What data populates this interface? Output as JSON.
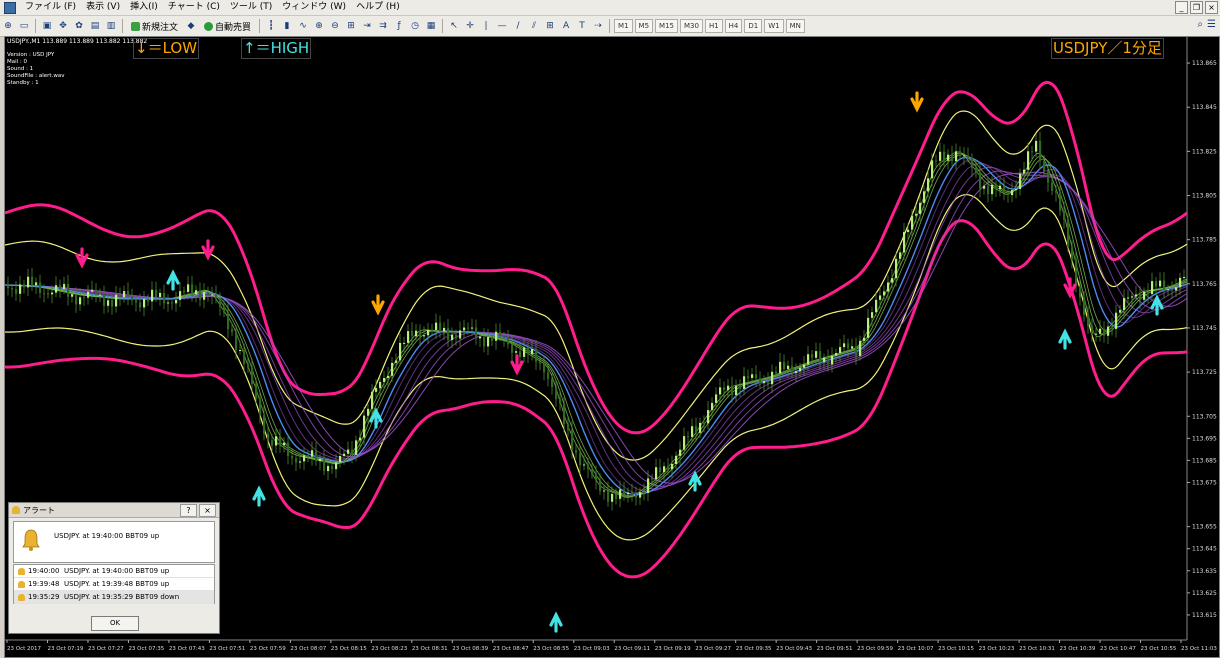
{
  "menu": {
    "items": [
      "ファイル (F)",
      "表示 (V)",
      "挿入(I)",
      "チャート (C)",
      "ツール (T)",
      "ウィンドウ (W)",
      "ヘルプ (H)"
    ]
  },
  "window_controls": [
    "_",
    "❐",
    "×"
  ],
  "toolbar": {
    "new_order": "新規注文",
    "auto_trade": "自動売買",
    "draw_tools": [
      "|",
      "—",
      "/",
      "⫽",
      "⊞",
      "A",
      "T"
    ],
    "timeframes": [
      "M1",
      "M5",
      "M15",
      "M30",
      "H1",
      "H4",
      "D1",
      "W1",
      "MN"
    ]
  },
  "chart_window": {
    "symbol_line": "USDJPY.,M1  113.889 113.889 113.882 113.882",
    "info": [
      "Version : USD JPY",
      "Mail : 0",
      "Sound : 1",
      "SoundFile : alert.wav",
      "Standby : 1"
    ],
    "legend_low": "↓＝LOW",
    "legend_high": "↑＝HIGH",
    "chart_title": "USDJPY／1分足",
    "colors": {
      "background": "#000000",
      "outer_band": "#ff1c8c",
      "inner_band": "#f2f27a",
      "ma_blue": "#4b8cf0",
      "ma_purple": "#a050d0",
      "candles": "#b6f07a",
      "low_arrow": "#ffa500",
      "high_arrow": "#43e3e3"
    }
  },
  "alert_dialog": {
    "title": "アラート",
    "buttons": [
      "?",
      "×"
    ],
    "message": "USDJPY. at 19:40:00 BBT09 up",
    "rows": [
      {
        "time": "19:40:00",
        "text": "USDJPY. at 19:40:00 BBT09 up"
      },
      {
        "time": "19:39:48",
        "text": "USDJPY. at 19:39:48 BBT09 up"
      },
      {
        "time": "19:35:29",
        "text": "USDJPY. at 19:35:29 BBT09 down"
      }
    ],
    "ok_label": "OK"
  },
  "chart_data": {
    "type": "line",
    "title": "USDJPY／1分足",
    "y_ticks": [
      113.865,
      113.845,
      113.825,
      113.805,
      113.785,
      113.765,
      113.745,
      113.725,
      113.705,
      113.695,
      113.685,
      113.675,
      113.655,
      113.645,
      113.635,
      113.625,
      113.615
    ],
    "x_ticks": [
      "23 Oct 2017",
      "23 Oct 07:19",
      "23 Oct 07:27",
      "23 Oct 07:35",
      "23 Oct 07:43",
      "23 Oct 07:51",
      "23 Oct 07:59",
      "23 Oct 08:07",
      "23 Oct 08:15",
      "23 Oct 08:23",
      "23 Oct 08:31",
      "23 Oct 08:39",
      "23 Oct 08:47",
      "23 Oct 08:55",
      "23 Oct 09:03",
      "23 Oct 09:11",
      "23 Oct 09:19",
      "23 Oct 09:27",
      "23 Oct 09:35",
      "23 Oct 09:43",
      "23 Oct 09:51",
      "23 Oct 09:59",
      "23 Oct 10:07",
      "23 Oct 10:15",
      "23 Oct 10:23",
      "23 Oct 10:31",
      "23 Oct 10:39",
      "23 Oct 10:47",
      "23 Oct 10:55",
      "23 Oct 11:03"
    ]
  }
}
